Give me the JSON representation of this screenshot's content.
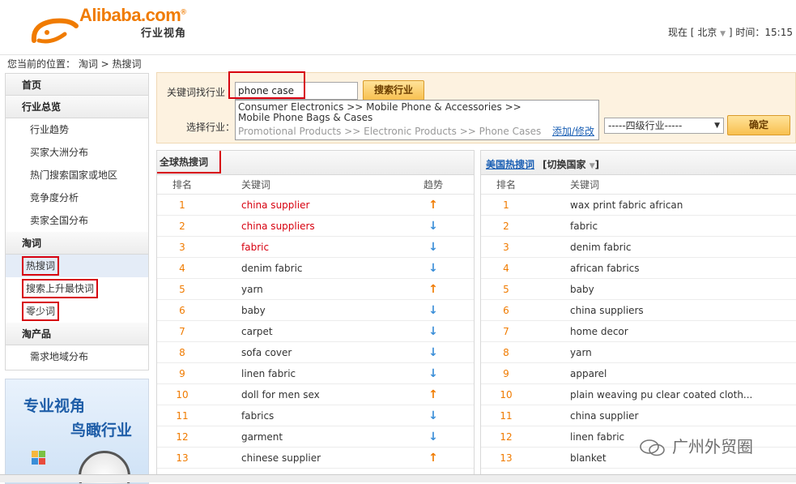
{
  "header": {
    "logo_text": "Alibaba.com",
    "logo_sub": "行业视角",
    "now_label": "现在 [",
    "city": "北京",
    "time_label": "] 时间：",
    "time": "15:15"
  },
  "breadcrumb": "您当前的位置： 淘词 > 热搜词",
  "sidebar": {
    "home": "首页",
    "overview": "行业总览",
    "overview_items": [
      "行业趋势",
      "买家大洲分布",
      "热门搜索国家或地区",
      "竞争度分析",
      "卖家全国分布"
    ],
    "taoci": "淘词",
    "taoci_items": [
      "热搜词",
      "搜索上升最快词",
      "零少词"
    ],
    "taochanpin": "淘产品",
    "taochanpin_items": [
      "需求地域分布"
    ],
    "promo_line1": "专业视角",
    "promo_line2": "鸟瞰行业"
  },
  "search": {
    "keyword_label": "关键词找行业",
    "keyword_value": "phone case",
    "search_button": "搜索行业",
    "select_label": "选择行业：",
    "suggestion1": "Consumer Electronics >> Mobile Phone & Accessories >>",
    "suggestion1b": "Mobile Phone Bags & Cases",
    "suggestion2": "Promotional Products >> Electronic Products >> Phone Cases",
    "edit_link": "添加/修改",
    "level4_select": "-----四级行业-----",
    "ok_button": "确定"
  },
  "global_panel": {
    "title": "全球热搜词",
    "col_rank": "排名",
    "col_keyword": "关键词",
    "col_trend": "趋势",
    "rows": [
      {
        "rank": "1",
        "keyword": "china supplier",
        "trend": "↑",
        "dir": "up",
        "red": true
      },
      {
        "rank": "2",
        "keyword": "china suppliers",
        "trend": "↓",
        "dir": "down",
        "red": true
      },
      {
        "rank": "3",
        "keyword": "fabric",
        "trend": "↓",
        "dir": "down",
        "red": true
      },
      {
        "rank": "4",
        "keyword": "denim fabric",
        "trend": "↓",
        "dir": "down",
        "red": false
      },
      {
        "rank": "5",
        "keyword": "yarn",
        "trend": "↑",
        "dir": "up",
        "red": false
      },
      {
        "rank": "6",
        "keyword": "baby",
        "trend": "↓",
        "dir": "down",
        "red": false
      },
      {
        "rank": "7",
        "keyword": "carpet",
        "trend": "↓",
        "dir": "down",
        "red": false
      },
      {
        "rank": "8",
        "keyword": "sofa cover",
        "trend": "↓",
        "dir": "down",
        "red": false
      },
      {
        "rank": "9",
        "keyword": "linen fabric",
        "trend": "↓",
        "dir": "down",
        "red": false
      },
      {
        "rank": "10",
        "keyword": "doll for men sex",
        "trend": "↑",
        "dir": "up",
        "red": false
      },
      {
        "rank": "11",
        "keyword": "fabrics",
        "trend": "↓",
        "dir": "down",
        "red": false
      },
      {
        "rank": "12",
        "keyword": "garment",
        "trend": "↓",
        "dir": "down",
        "red": false
      },
      {
        "rank": "13",
        "keyword": "chinese supplier",
        "trend": "↑",
        "dir": "up",
        "red": false
      }
    ]
  },
  "us_panel": {
    "title": "美国热搜词",
    "switch_label": "[切换国家",
    "switch_end": "]",
    "col_rank": "排名",
    "col_keyword": "关键词",
    "rows": [
      {
        "rank": "1",
        "keyword": "wax print fabric african"
      },
      {
        "rank": "2",
        "keyword": "fabric"
      },
      {
        "rank": "3",
        "keyword": "denim fabric"
      },
      {
        "rank": "4",
        "keyword": "african fabrics"
      },
      {
        "rank": "5",
        "keyword": "baby"
      },
      {
        "rank": "6",
        "keyword": "china suppliers"
      },
      {
        "rank": "7",
        "keyword": "home decor"
      },
      {
        "rank": "8",
        "keyword": "yarn"
      },
      {
        "rank": "9",
        "keyword": "apparel"
      },
      {
        "rank": "10",
        "keyword": "plain weaving pu clear coated cloth..."
      },
      {
        "rank": "11",
        "keyword": "china supplier"
      },
      {
        "rank": "12",
        "keyword": "linen fabric"
      },
      {
        "rank": "13",
        "keyword": "blanket"
      }
    ]
  },
  "watermark": "广州外贸圈",
  "colors": {
    "accent": "#f07b00",
    "highlight": "#d7000f",
    "link": "#1a5fb4",
    "down_arrow": "#3a8ed8"
  }
}
